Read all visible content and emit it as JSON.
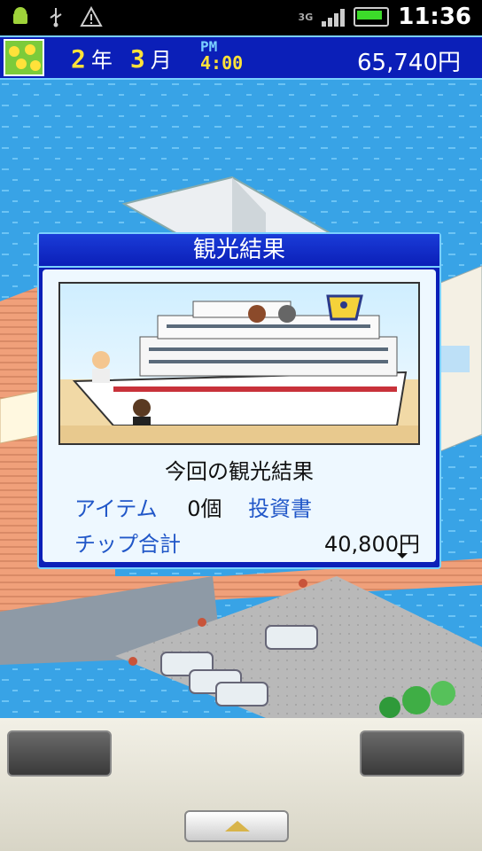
{
  "status_bar": {
    "time": "11:36",
    "network": "3G",
    "icons": [
      "android-icon",
      "usb-icon",
      "warning-icon",
      "signal-icon",
      "battery-icon"
    ]
  },
  "hud": {
    "year_num": "2",
    "year_unit": "年",
    "month_num": "3",
    "month_unit": "月",
    "ampm": "PM",
    "clock": "4:00",
    "money": "65,740円"
  },
  "dialog": {
    "title": "観光結果",
    "subtitle": "今回の観光結果",
    "item_label": "アイテム",
    "item_count": "0個",
    "item_reward": "投資書",
    "tip_label": "チップ合計",
    "tip_value": "40,800円"
  },
  "colors": {
    "hud_bg": "#0b1fb8",
    "accent": "#7ad0ff",
    "gold": "#ffe23a",
    "label_blue": "#2157c8",
    "sea": "#3aa6e8"
  }
}
